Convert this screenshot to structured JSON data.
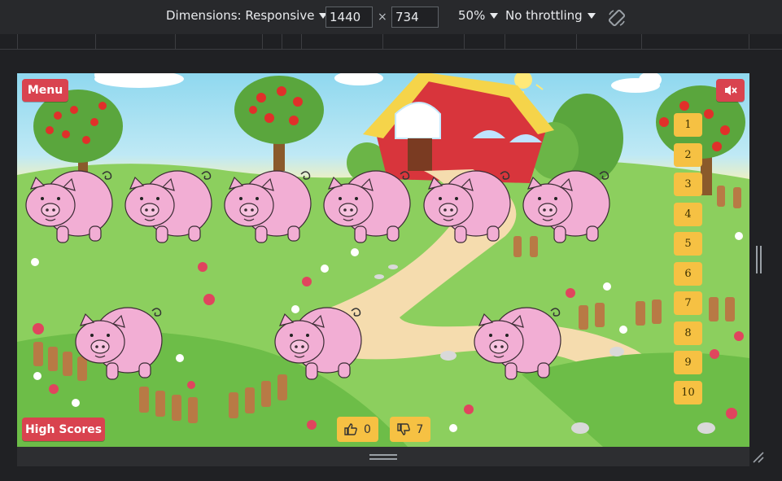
{
  "devtools": {
    "dimensions_label": "Dimensions: Responsive",
    "width_value": "1440",
    "height_value": "734",
    "times_symbol": "×",
    "zoom": "50%",
    "throttling": "No throttling",
    "rotate_icon": "rotate-icon"
  },
  "game": {
    "menu_label": "Menu",
    "mute_icon": "mute-icon",
    "high_scores_label": "High Scores",
    "number_buttons": [
      "1",
      "2",
      "3",
      "4",
      "5",
      "6",
      "7",
      "8",
      "9",
      "10"
    ],
    "thumbs_up_count": "0",
    "thumbs_down_count": "7",
    "pigs_top_row_count": 6,
    "pigs_bottom_row_count": 3,
    "colors": {
      "red_button": "#d9434f",
      "number_button": "#f6c143",
      "pig_pink": "#f2aed4",
      "grass": "#7cc653",
      "barn_red": "#d8353c",
      "barn_roof": "#f5d44a"
    }
  }
}
